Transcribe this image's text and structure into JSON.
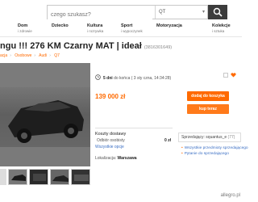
{
  "search": {
    "placeholder": "czego szukasz?",
    "category": "QT"
  },
  "categories": [
    {
      "title": "Dom",
      "sub": "i zdrowie"
    },
    {
      "title": "Dziecko",
      "sub": ""
    },
    {
      "title": "Kultura",
      "sub": "i rozrywka"
    },
    {
      "title": "Sport",
      "sub": "i wypoczynek"
    },
    {
      "title": "Motoryzacja",
      "sub": ""
    },
    {
      "title": "Kolekcje",
      "sub": "i sztuka"
    }
  ],
  "listing": {
    "title": "ngu !!! 276 KM Czarny MAT | ideał",
    "id": "(3816301649)",
    "breadcrumbs": [
      "acja",
      "Osobowe",
      "Audi",
      "Q7"
    ],
    "time_label": "5 dni",
    "time_detail": "do końca (  3 sty czna, 14:34:28)",
    "price": "139 000 zł",
    "add_to_cart": "dodaj do koszyka",
    "buy_now": "kup teraz"
  },
  "costs": {
    "title": "Koszty dostawy",
    "row_label": "Odbiór osobisty",
    "row_value": "0 zł",
    "link": "Wszystkie opcje"
  },
  "location": {
    "label": "Lokalizacja:",
    "value": "Warszawa"
  },
  "seller": {
    "name": "Sprzedający: squantus_e",
    "count": "(77)",
    "links": [
      "Wszystkie przedmioty sprzedającego",
      "Pytanie do sprzedającego"
    ]
  },
  "footer": {
    "brand": "allegro.pl"
  },
  "colors": {
    "accent": "#ff6a00",
    "link": "#3b6fc4",
    "dark": "#3c3c3c"
  }
}
